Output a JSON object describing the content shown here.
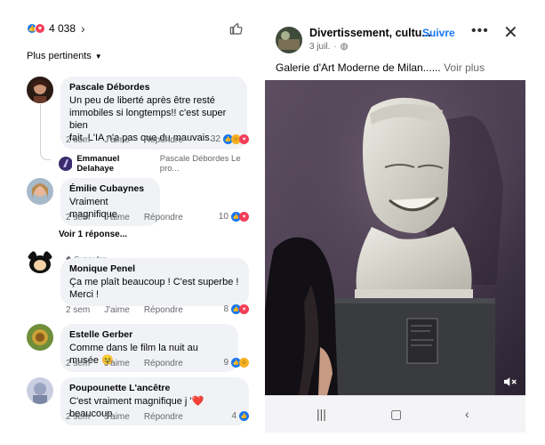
{
  "reactions": {
    "count": "4 038"
  },
  "sort": {
    "label": "Plus pertinents"
  },
  "comments": [
    {
      "name": "Pascale Débordes",
      "text_lines": [
        "Un peu de liberté après être resté",
        "immobiles si longtemps!! c'est super bien",
        "fait, L'IA n'a pas que du mauvais."
      ],
      "time": "2 sem",
      "like": "J'aime",
      "reply": "Répondre",
      "reaction_count": "32"
    },
    {
      "name": "Émilie Cubaynes",
      "text_lines": [
        "Vraiment magnifique."
      ],
      "time": "2 sem",
      "like": "J'aime",
      "reply": "Répondre",
      "reaction_count": "10"
    },
    {
      "name": "Monique Penel",
      "badge": "Super fan",
      "text_lines": [
        "Ça me plaît beaucoup ! C'est superbe !",
        "Merci !"
      ],
      "time": "2 sem",
      "like": "J'aime",
      "reply": "Répondre",
      "reaction_count": "8"
    },
    {
      "name": "Estelle Gerber",
      "text_lines": [
        "Comme dans le film la nuit au musée 😊"
      ],
      "time": "2 sem",
      "like": "J'aime",
      "reply": "Répondre",
      "reaction_count": "9"
    },
    {
      "name": "Poupounette L'ancêtre",
      "text_lines": [
        "C'est vraiment magnifique j '❤️beaucoup"
      ],
      "time": "2 sem",
      "like": "J'aime",
      "reply": "Répondre",
      "reaction_count": "4"
    }
  ],
  "reply_preview": {
    "name": "Emmanuel Delahaye",
    "text": "Pascale Débordes Le pro..."
  },
  "see_replies": "Voir 1 réponse...",
  "post": {
    "page_name": "Divertissement, cultu...",
    "follow": "Suivre",
    "date": "3 juil.",
    "caption": "Galerie d'Art Moderne de Milan......",
    "see_more": "Voir plus"
  },
  "icons": [
    "like-icon",
    "love-icon",
    "care-icon",
    "haha-icon",
    "chevron-right-icon",
    "thumbs-up-icon",
    "caret-down-icon",
    "globe-icon",
    "more-icon",
    "close-icon",
    "mute-icon",
    "recents-icon",
    "home-icon",
    "back-icon"
  ],
  "colors": {
    "brand": "#1877f2",
    "love": "#f33e58",
    "bubble": "#f0f2f5",
    "muted": "#65676b"
  }
}
